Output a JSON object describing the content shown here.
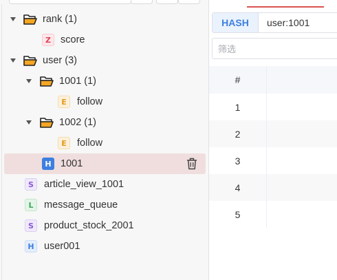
{
  "tree": {
    "groups": [
      {
        "label": "rank (1)",
        "expanded": true
      },
      {
        "label": "user (3)",
        "expanded": true
      },
      {
        "label": "1001 (1)",
        "expanded": true
      },
      {
        "label": "1002 (1)",
        "expanded": true
      }
    ],
    "keys": [
      {
        "type": "Z",
        "label": "score"
      },
      {
        "type": "E",
        "label": "follow"
      },
      {
        "type": "E",
        "label": "follow"
      },
      {
        "type": "H",
        "label": "1001",
        "selected": true
      },
      {
        "type": "S",
        "label": "article_view_1001"
      },
      {
        "type": "L",
        "label": "message_queue"
      },
      {
        "type": "S",
        "label": "product_stock_2001"
      },
      {
        "type": "H",
        "label": "user001"
      }
    ],
    "delete_icon": "trash-icon"
  },
  "detail": {
    "key_type": "HASH",
    "key_name": "user:1001",
    "filter_placeholder": "筛选",
    "table": {
      "index_header": "#",
      "rows": [
        "1",
        "2",
        "3",
        "4",
        "5"
      ]
    }
  },
  "colors": {
    "accent": "#3d7fe0",
    "selected_row": "#f0dede",
    "tab_indicator": "#d9534f",
    "folder": "#f5a623"
  }
}
